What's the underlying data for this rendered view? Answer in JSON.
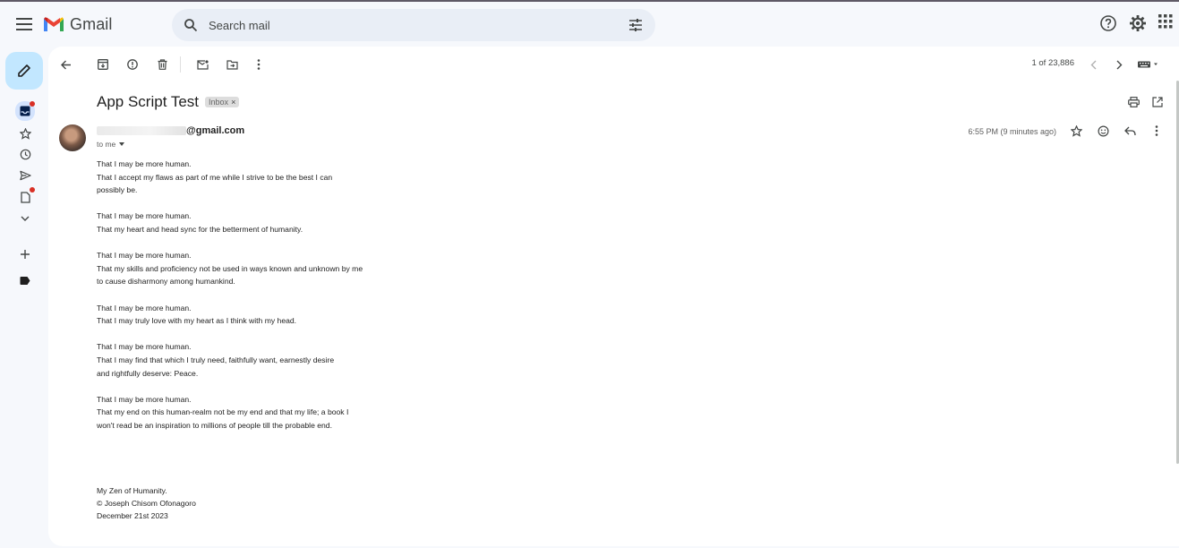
{
  "app": {
    "name": "Gmail",
    "accent": "#c2e7ff",
    "logo_colors": [
      "#4285f4",
      "#ea4335",
      "#fbbc04",
      "#34a853",
      "#c5221f"
    ]
  },
  "search": {
    "placeholder": "Search mail",
    "value": ""
  },
  "toolbar": {
    "count": "1 of 23,886"
  },
  "email": {
    "subject": "App Script Test",
    "label": "Inbox",
    "label_remove": "×",
    "sender_visible": "@gmail.com",
    "to": "to me",
    "time": "6:55 PM (9 minutes ago)",
    "paragraphs": [
      [
        "That I may be more human.",
        "That I accept my flaws as part of me while I strive to be the best I can",
        "possibly be."
      ],
      [
        "That I may be more human.",
        "That my heart and head sync for the betterment of humanity."
      ],
      [
        "That I may be more human.",
        "That my skills and proficiency not be used in ways known and unknown by me",
        "to cause disharmony among humankind."
      ],
      [
        "That I may be more human.",
        "That I may truly love with my heart as I think with my head."
      ],
      [
        "That I may be more human.",
        "That I may find that which I truly need, faithfully want, earnestly desire",
        "and rightfully deserve: Peace."
      ],
      [
        "That I may be more human.",
        "That my end on this human-realm not be my end and that my life; a book I",
        "won't read be an inspiration to millions of people till the probable end."
      ]
    ],
    "signature": [
      "My Zen of Humanity.",
      "© Joseph Chisom Ofonagoro",
      "December 21st 2023"
    ]
  },
  "icons": {
    "menu": "menu-icon",
    "search": "search-icon",
    "tune": "tune-icon",
    "help": "help-icon",
    "settings": "gear-icon",
    "apps": "apps-grid-icon"
  }
}
